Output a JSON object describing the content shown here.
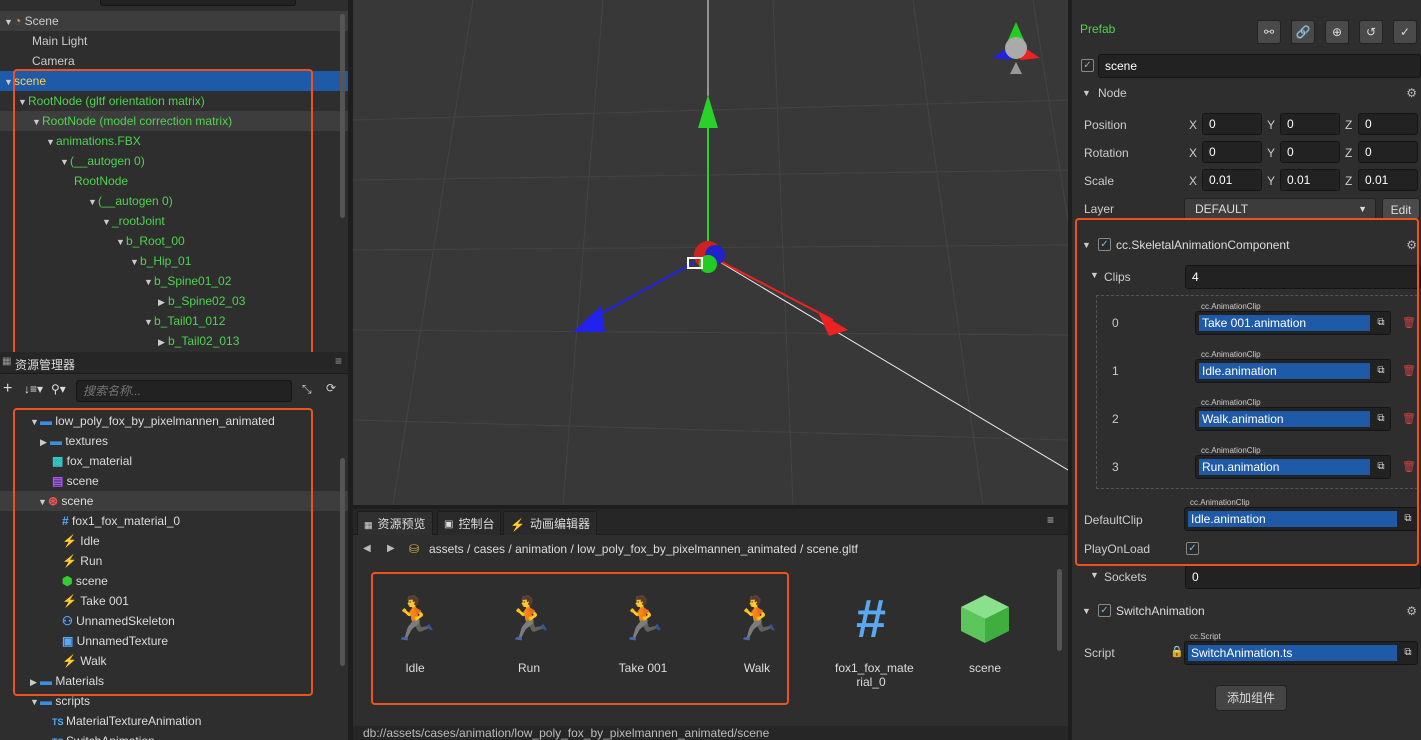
{
  "hierarchy": {
    "rows": [
      {
        "label": "Scene",
        "icon": "scene-icon",
        "style": "root"
      },
      {
        "label": "Main Light"
      },
      {
        "label": "Camera"
      },
      {
        "label": "scene"
      },
      {
        "label": "RootNode (gltf orientation matrix)"
      },
      {
        "label": "RootNode (model correction matrix)"
      },
      {
        "label": "animations.FBX"
      },
      {
        "label": "(__autogen 0)"
      },
      {
        "label": "RootNode"
      },
      {
        "label": "(__autogen 0)"
      },
      {
        "label": "_rootJoint"
      },
      {
        "label": "b_Root_00"
      },
      {
        "label": "b_Hip_01"
      },
      {
        "label": "b_Spine01_02"
      },
      {
        "label": "b_Spine02_03"
      },
      {
        "label": "b_Tail01_012"
      },
      {
        "label": "b_Tail02_013"
      }
    ]
  },
  "assets": {
    "title": "资源管理器",
    "search_placeholder": "搜索名称...",
    "rows": [
      {
        "label": "low_poly_fox_by_pixelmannen_animated"
      },
      {
        "label": "textures"
      },
      {
        "label": "fox_material"
      },
      {
        "label": "scene"
      },
      {
        "label": "scene"
      },
      {
        "label": "fox1_fox_material_0"
      },
      {
        "label": "Idle"
      },
      {
        "label": "Run"
      },
      {
        "label": "scene"
      },
      {
        "label": "Take 001"
      },
      {
        "label": "UnnamedSkeleton"
      },
      {
        "label": "UnnamedTexture"
      },
      {
        "label": "Walk"
      },
      {
        "label": "Materials"
      },
      {
        "label": "scripts"
      },
      {
        "label": "MaterialTextureAnimation"
      },
      {
        "label": "SwitchAnimation"
      }
    ]
  },
  "bottom": {
    "tabs": [
      "资源预览",
      "控制台",
      "动画编辑器"
    ],
    "breadcrumb": [
      "assets",
      "cases",
      "animation",
      "low_poly_fox_by_pixelmannen_animated",
      "scene.gltf"
    ],
    "items": [
      {
        "label": "Idle",
        "icon": "running-man-icon"
      },
      {
        "label": "Run",
        "icon": "running-man-icon"
      },
      {
        "label": "Take 001",
        "icon": "running-man-icon"
      },
      {
        "label": "Walk",
        "icon": "running-man-icon"
      },
      {
        "label": "fox1_fox_mate rial_0",
        "icon": "mesh-grid-icon"
      },
      {
        "label": "scene",
        "icon": "cube-icon"
      }
    ],
    "status_path": "db://assets/cases/animation/low_poly_fox_by_pixelmannen_animated/scene"
  },
  "inspector": {
    "prefab_label": "Prefab",
    "node_name": "scene",
    "node_section": "Node",
    "position_label": "Position",
    "rotation_label": "Rotation",
    "scale_label": "Scale",
    "layer_label": "Layer",
    "axis": {
      "x": "X",
      "y": "Y",
      "z": "Z"
    },
    "position": [
      "0",
      "0",
      "0"
    ],
    "rotation": [
      "0",
      "0",
      "0"
    ],
    "scale": [
      "0.01",
      "0.01",
      "0.01"
    ],
    "layer_value": "DEFAULT",
    "edit_label": "Edit",
    "skel_component": "cc.SkeletalAnimationComponent",
    "clips_label": "Clips",
    "clips_count": "4",
    "clip_type": "cc.AnimationClip",
    "clips": [
      {
        "index": "0",
        "value": "Take 001.animation"
      },
      {
        "index": "1",
        "value": "Idle.animation"
      },
      {
        "index": "2",
        "value": "Walk.animation"
      },
      {
        "index": "3",
        "value": "Run.animation"
      }
    ],
    "default_clip_label": "DefaultClip",
    "default_clip_value": "Idle.animation",
    "play_on_load_label": "PlayOnLoad",
    "sockets_label": "Sockets",
    "sockets_value": "0",
    "switch_component": "SwitchAnimation",
    "script_label": "Script",
    "script_type": "cc.Script",
    "script_value": "SwitchAnimation.ts",
    "add_component": "添加组件"
  },
  "colors": {
    "accent": "#1e5aa8",
    "highlight": "#f0521e",
    "green_text": "#4ed44e"
  }
}
